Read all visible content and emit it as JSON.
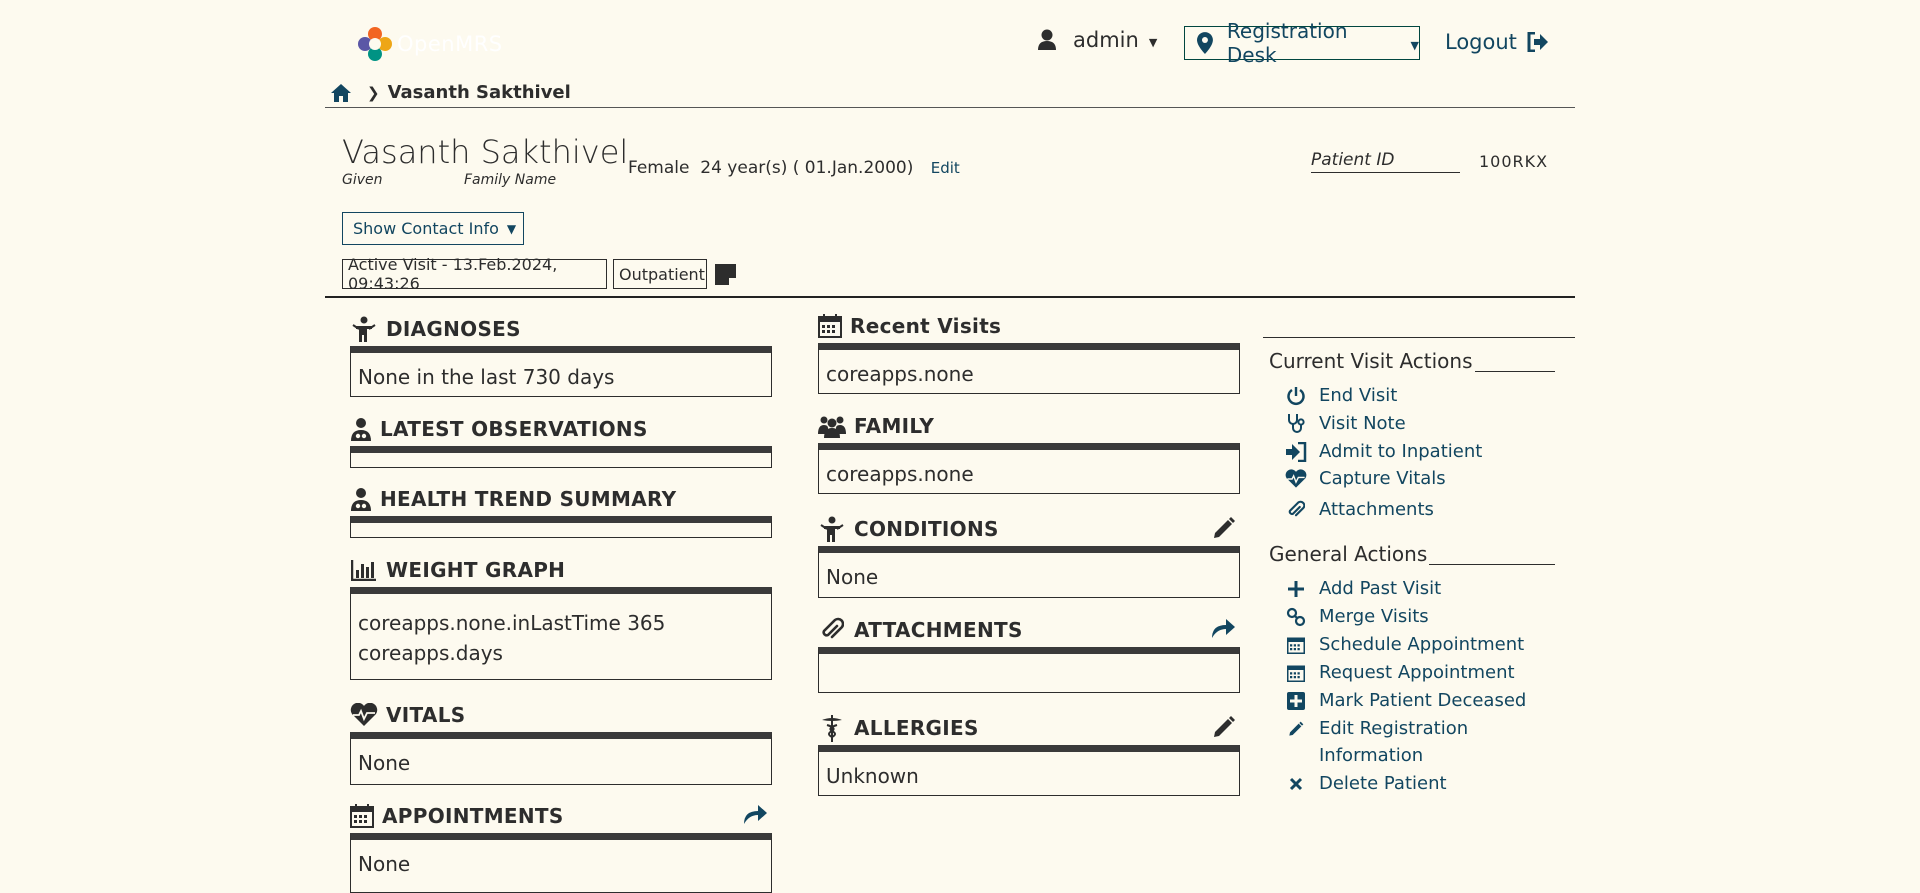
{
  "header": {
    "logo_text": "OpenMRS",
    "user": "admin",
    "location": "Registration Desk",
    "logout": "Logout"
  },
  "breadcrumb": {
    "current": "Vasanth Sakthivel"
  },
  "patient": {
    "name": "Vasanth Sakthivel",
    "given_label": "Given",
    "family_label": "Family Name",
    "info": "Female  24 year(s) ( 01.Jan.2000)",
    "edit": "Edit",
    "id_label": "Patient ID",
    "id_value": "100RKX",
    "contact_button": "Show Contact Info",
    "active_visit": "Active Visit - 13.Feb.2024, 09:43:26",
    "visit_type": "Outpatient"
  },
  "left_widgets": {
    "diagnoses": {
      "title": "DIAGNOSES",
      "body": "None in the last 730 days"
    },
    "latest_obs": {
      "title": "LATEST OBSERVATIONS"
    },
    "health_trend": {
      "title": "HEALTH TREND SUMMARY"
    },
    "weight_graph": {
      "title": "WEIGHT GRAPH",
      "body": "coreapps.none.inLastTime 365 coreapps.days"
    },
    "vitals": {
      "title": "VITALS",
      "body": "None"
    },
    "appointments": {
      "title": "APPOINTMENTS",
      "body": "None"
    }
  },
  "middle_widgets": {
    "recent_visits": {
      "title": "Recent Visits",
      "body": "coreapps.none"
    },
    "family": {
      "title": "FAMILY",
      "body": "coreapps.none"
    },
    "conditions": {
      "title": "CONDITIONS",
      "body": "None"
    },
    "attachments": {
      "title": "ATTACHMENTS"
    },
    "allergies": {
      "title": "ALLERGIES",
      "body": "Unknown"
    }
  },
  "actions": {
    "current_title": "Current Visit Actions",
    "current": [
      "End Visit",
      "Visit Note",
      "Admit to Inpatient",
      "Capture Vitals",
      "Attachments"
    ],
    "general_title": "General Actions",
    "general": [
      "Add Past Visit",
      "Merge Visits",
      "Schedule Appointment",
      "Request Appointment",
      "Mark Patient Deceased",
      "Edit Registration Information",
      "Delete Patient"
    ]
  },
  "colors": {
    "link": "#124660",
    "text": "#2d2d2d",
    "background": "#fdfaef"
  }
}
